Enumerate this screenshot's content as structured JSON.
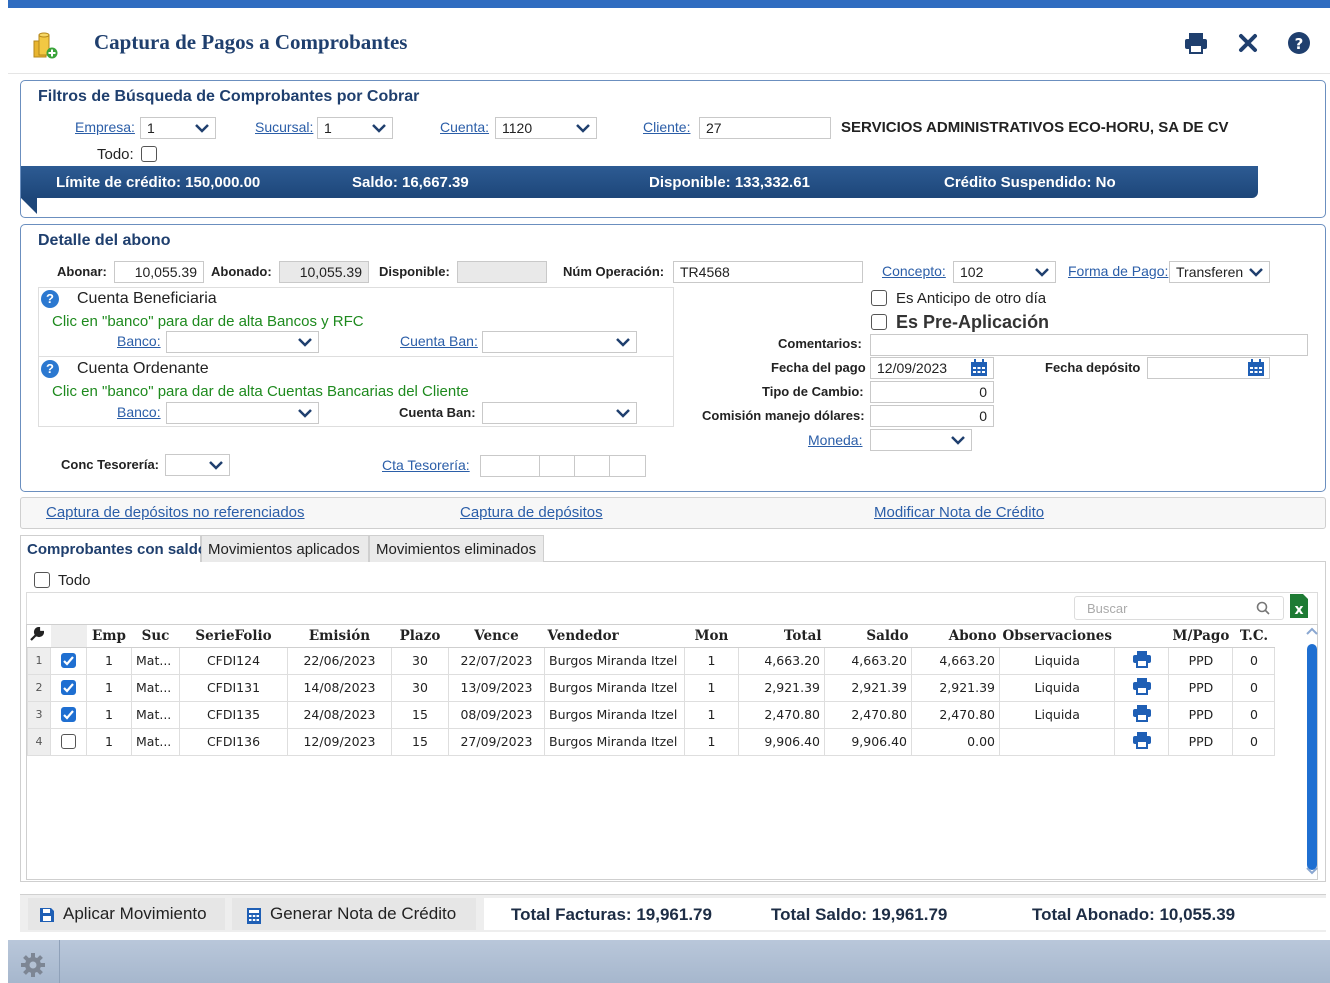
{
  "header": {
    "title": "Captura de Pagos a Comprobantes"
  },
  "filters": {
    "title": "Filtros de Búsqueda de Comprobantes por Cobrar",
    "empresa_label": "Empresa:",
    "empresa_value": "1",
    "sucursal_label": "Sucursal:",
    "sucursal_value": "1",
    "cuenta_label": "Cuenta:",
    "cuenta_value": "1120",
    "cliente_label": "Cliente:",
    "cliente_value": "27",
    "cliente_name": "SERVICIOS ADMINISTRATIVOS ECO-HORU, SA DE CV",
    "todo_label": "Todo:",
    "credit_limit": "Límite de crédito: 150,000.00",
    "saldo": "Saldo: 16,667.39",
    "disponible": "Disponible: 133,332.61",
    "credito_suspendido": "Crédito Suspendido: No"
  },
  "detail": {
    "title": "Detalle del abono",
    "abonar_label": "Abonar:",
    "abonar_value": "10,055.39",
    "abonado_label": "Abonado:",
    "abonado_value": "10,055.39",
    "disponible_label": "Disponible:",
    "disponible_value": "",
    "num_operacion_label": "Núm Operación:",
    "num_operacion_value": "TR4568",
    "concepto_label": "Concepto:",
    "concepto_value": "102",
    "forma_pago_label": "Forma de Pago:",
    "forma_pago_value": "Transferen",
    "beneficiaria_title": "Cuenta Beneficiaria",
    "beneficiaria_hint": "Clic en \"banco\" para dar de alta Bancos y RFC",
    "banco_label": "Banco:",
    "cuenta_ban_label": "Cuenta Ban:",
    "ordenante_title": "Cuenta Ordenante",
    "ordenante_hint": "Clic en \"banco\" para dar de alta Cuentas Bancarias del Cliente",
    "anticipo_label": "Es Anticipo de otro día",
    "preaplicacion_label": "Es Pre-Aplicación",
    "comentarios_label": "Comentarios:",
    "fecha_pago_label": "Fecha del pago",
    "fecha_pago_value": "12/09/2023",
    "fecha_deposito_label": "Fecha depósito",
    "tipo_cambio_label": "Tipo de Cambio:",
    "tipo_cambio_value": "0",
    "comision_label": "Comisión manejo dólares:",
    "comision_value": "0",
    "moneda_label": "Moneda:",
    "conc_tesoreria_label": "Conc Tesorería:",
    "cta_tesoreria_label": "Cta Tesorería:"
  },
  "links": {
    "no_referenciados": "Captura de depósitos no referenciados",
    "depositos": "Captura de depósitos",
    "nota_credito": "Modificar Nota de Crédito"
  },
  "tabs": [
    {
      "label": "Comprobantes con saldo"
    },
    {
      "label": "Movimientos aplicados"
    },
    {
      "label": "Movimientos eliminados"
    }
  ],
  "grid": {
    "todo_label": "Todo",
    "search_placeholder": "Buscar",
    "columns": [
      "Emp",
      "Suc",
      "SerieFolio",
      "Emisión",
      "Plazo",
      "Vence",
      "Vendedor",
      "Mon",
      "Total",
      "Saldo",
      "Abono",
      "Observaciones",
      "M/Pago",
      "T.C."
    ],
    "rows": [
      {
        "n": "1",
        "checked": true,
        "emp": "1",
        "suc": "Mat...",
        "folio": "CFDI124",
        "emision": "22/06/2023",
        "plazo": "30",
        "vence": "22/07/2023",
        "vendedor": "Burgos Miranda Itzel",
        "mon": "1",
        "total": "4,663.20",
        "saldo": "4,663.20",
        "abono": "4,663.20",
        "obs": "Liquida",
        "mpago": "PPD",
        "tc": "0"
      },
      {
        "n": "2",
        "checked": true,
        "emp": "1",
        "suc": "Mat...",
        "folio": "CFDI131",
        "emision": "14/08/2023",
        "plazo": "30",
        "vence": "13/09/2023",
        "vendedor": "Burgos Miranda Itzel",
        "mon": "1",
        "total": "2,921.39",
        "saldo": "2,921.39",
        "abono": "2,921.39",
        "obs": "Liquida",
        "mpago": "PPD",
        "tc": "0"
      },
      {
        "n": "3",
        "checked": true,
        "emp": "1",
        "suc": "Mat...",
        "folio": "CFDI135",
        "emision": "24/08/2023",
        "plazo": "15",
        "vence": "08/09/2023",
        "vendedor": "Burgos Miranda Itzel",
        "mon": "1",
        "total": "2,470.80",
        "saldo": "2,470.80",
        "abono": "2,470.80",
        "obs": "Liquida",
        "mpago": "PPD",
        "tc": "0"
      },
      {
        "n": "4",
        "checked": false,
        "emp": "1",
        "suc": "Mat...",
        "folio": "CFDI136",
        "emision": "12/09/2023",
        "plazo": "15",
        "vence": "27/09/2023",
        "vendedor": "Burgos Miranda Itzel",
        "mon": "1",
        "total": "9,906.40",
        "saldo": "9,906.40",
        "abono": "0.00",
        "obs": "",
        "mpago": "PPD",
        "tc": "0"
      }
    ]
  },
  "footer": {
    "aplicar_label": "Aplicar Movimiento",
    "generar_label": "Generar Nota de Crédito",
    "total_facturas": "Total Facturas: 19,961.79",
    "total_saldo": "Total Saldo: 19,961.79",
    "total_abonado": "Total Abonado: 10,055.39"
  },
  "colors": {
    "accent": "#1f3f6e",
    "link": "#2b5ea8",
    "infobar": "#2d5b93",
    "hint_green": "#1e8a1e"
  }
}
